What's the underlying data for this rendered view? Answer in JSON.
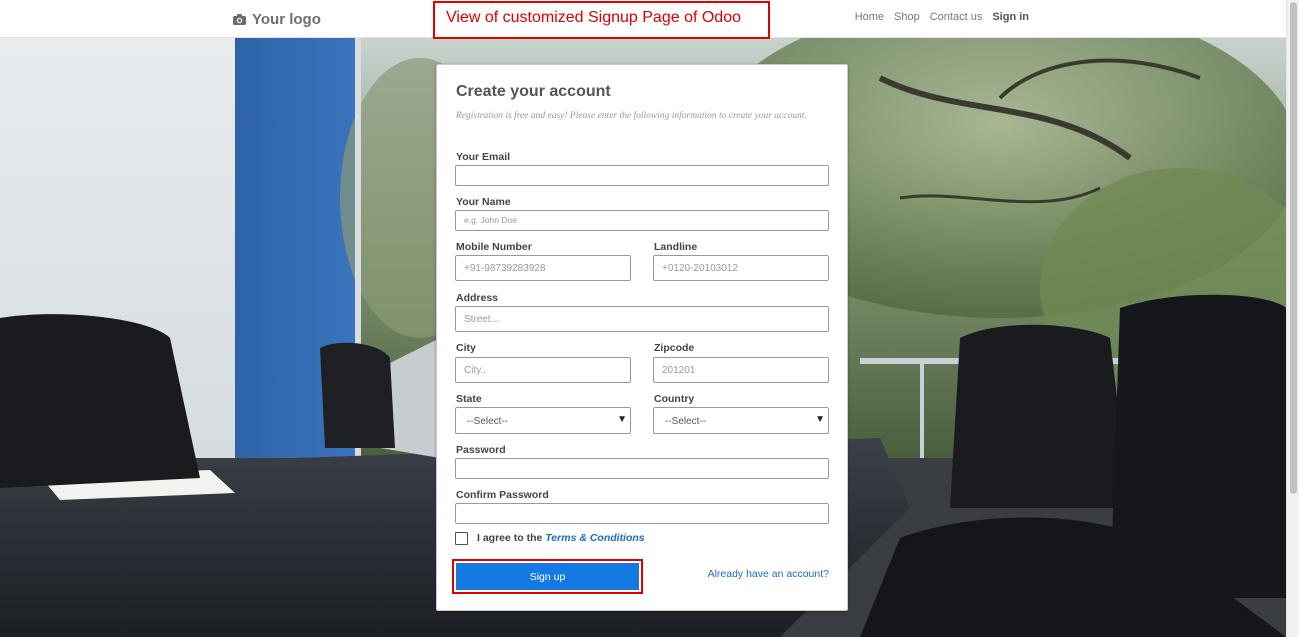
{
  "nav": {
    "logo_text": "Your logo",
    "logo_icon": "camera-icon",
    "links": [
      "Home",
      "Shop",
      "Contact us"
    ],
    "signin_label": "Sign in"
  },
  "annotation": {
    "text": "View of customized Signup Page of Odoo",
    "color": "#e00000"
  },
  "form": {
    "title": "Create your account",
    "intro": "Registration is free and easy! Please enter the following information to create your account.",
    "email_label": "Your Email",
    "email_value": "",
    "name_label": "Your Name",
    "name_placeholder": "e.g. John Doe",
    "mobile_label": "Mobile Number",
    "mobile_placeholder": "+91-98739283928",
    "landline_label": "Landline",
    "landline_placeholder": "+0120-20103012",
    "address_label": "Address",
    "address_placeholder": "Street...",
    "city_label": "City",
    "city_placeholder": "City..",
    "zip_label": "Zipcode",
    "zip_placeholder": "201201",
    "state_label": "State",
    "state_selected": "--Select--",
    "country_label": "Country",
    "country_selected": "--Select--",
    "password_label": "Password",
    "confirm_label": "Confirm Password",
    "agree_prefix": "I agree to the",
    "terms_link": "Terms & Conditions",
    "signup_label": "Sign up",
    "already_link": "Already have an account?"
  },
  "colors": {
    "accent": "#1479e2",
    "link": "#1a6cc9",
    "highlight": "#e00000"
  }
}
